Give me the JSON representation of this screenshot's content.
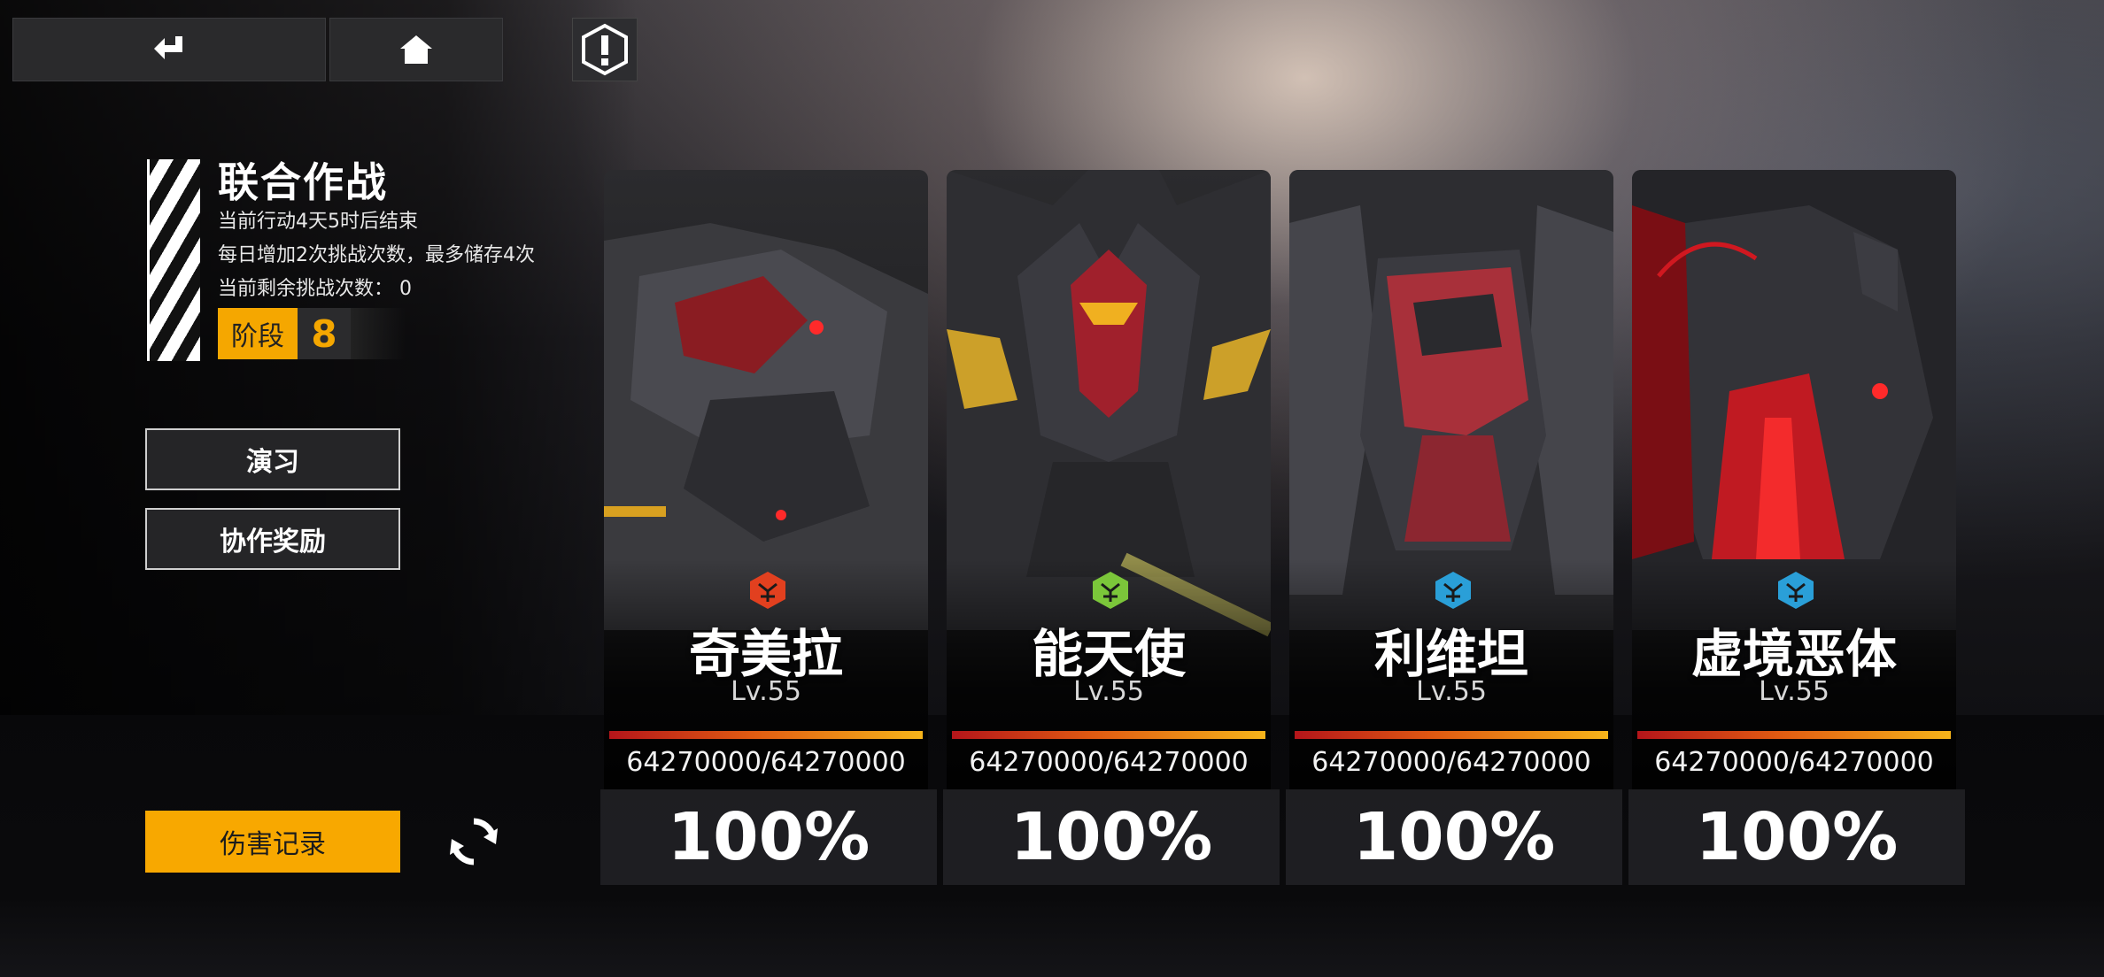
{
  "nav": {
    "back_icon": "return-arrow-icon",
    "home_icon": "home-icon",
    "alert_icon": "exclamation-hexagon-icon"
  },
  "event": {
    "title": "联合作战",
    "line1": "当前行动4天5时后结束",
    "line2": "每日增加2次挑战次数，最多储存4次",
    "line3": "当前剩余挑战次数： 0",
    "stage_label": "阶段",
    "stage_value": "8"
  },
  "buttons": {
    "practice": "演习",
    "coop_reward": "协作奖励",
    "damage_record": "伤害记录",
    "refresh_icon": "refresh-icon"
  },
  "colors": {
    "accent": "#f8a800",
    "hp_start": "#b4151a",
    "hp_end": "#f6b41a"
  },
  "bosses": [
    {
      "name": "奇美拉",
      "level": "Lv.55",
      "hp": "64270000/64270000",
      "hp_fraction": 1.0,
      "percent": "100%",
      "faction_color": "#e2401f",
      "faction_icon": "faction-emblem-icon"
    },
    {
      "name": "能天使",
      "level": "Lv.55",
      "hp": "64270000/64270000",
      "hp_fraction": 1.0,
      "percent": "100%",
      "faction_color": "#7bc63a",
      "faction_icon": "faction-emblem-icon"
    },
    {
      "name": "利维坦",
      "level": "Lv.55",
      "hp": "64270000/64270000",
      "hp_fraction": 1.0,
      "percent": "100%",
      "faction_color": "#2a9fd8",
      "faction_icon": "faction-emblem-icon"
    },
    {
      "name": "虚境恶体",
      "level": "Lv.55",
      "hp": "64270000/64270000",
      "hp_fraction": 1.0,
      "percent": "100%",
      "faction_color": "#2a9fd8",
      "faction_icon": "faction-emblem-icon"
    }
  ]
}
